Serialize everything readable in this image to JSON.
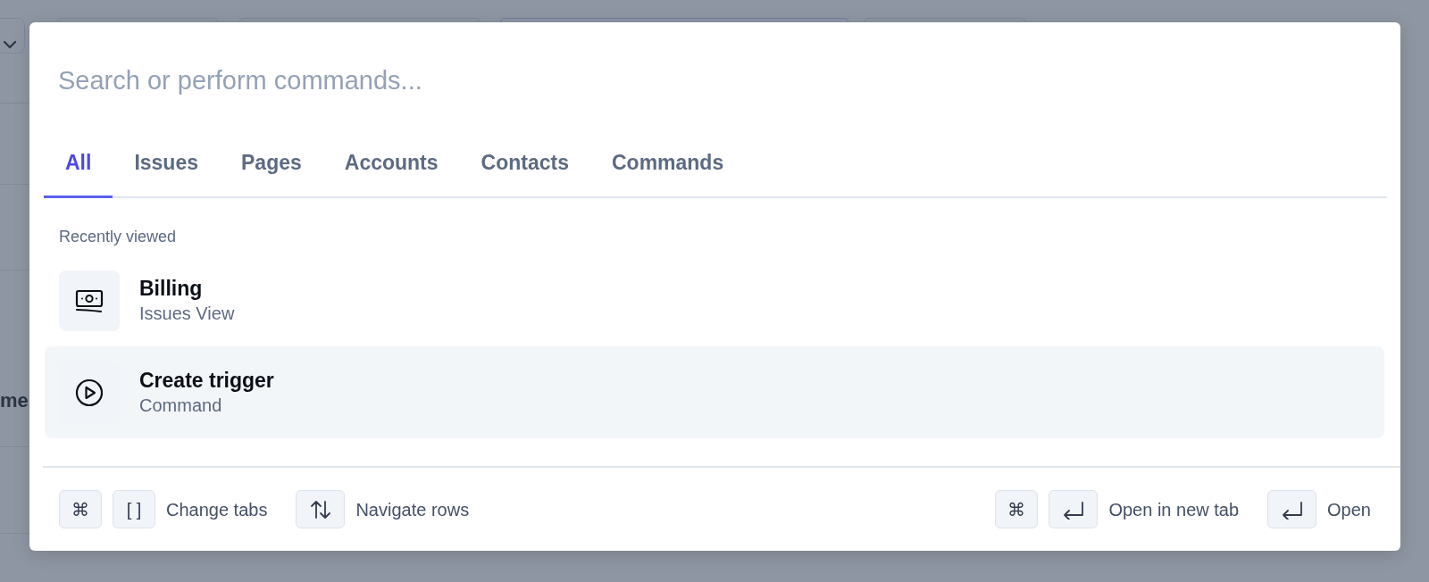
{
  "backdrop": {
    "text_fragment": "me"
  },
  "search": {
    "placeholder": "Search or perform commands..."
  },
  "tabs": [
    {
      "label": "All",
      "selected": true
    },
    {
      "label": "Issues",
      "selected": false
    },
    {
      "label": "Pages",
      "selected": false
    },
    {
      "label": "Accounts",
      "selected": false
    },
    {
      "label": "Contacts",
      "selected": false
    },
    {
      "label": "Commands",
      "selected": false
    }
  ],
  "section_title": "Recently viewed",
  "results": [
    {
      "kind": "money",
      "title": "Billing",
      "subtitle": "Issues View",
      "selected": false
    },
    {
      "kind": "play",
      "title": "Create trigger",
      "subtitle": "Command",
      "selected": true
    }
  ],
  "footer": {
    "left": [
      {
        "keys": [
          {
            "kind": "text",
            "label": "⌘"
          },
          {
            "kind": "text",
            "label": "[ ]"
          }
        ],
        "label": "Change tabs"
      },
      {
        "keys": [
          {
            "kind": "updown"
          }
        ],
        "label": "Navigate rows"
      }
    ],
    "right": [
      {
        "keys": [
          {
            "kind": "text",
            "label": "⌘"
          },
          {
            "kind": "enter"
          }
        ],
        "label": "Open in new tab"
      },
      {
        "keys": [
          {
            "kind": "enter"
          }
        ],
        "label": "Open"
      }
    ]
  }
}
